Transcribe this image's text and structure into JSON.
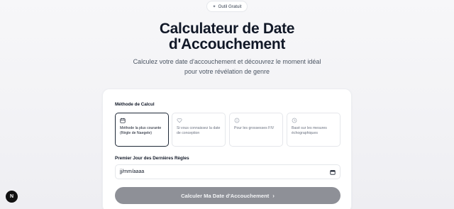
{
  "badge": {
    "label": "Outil Gratuit",
    "icon": "sparkle-icon"
  },
  "header": {
    "title_line1": "Calculateur de Date",
    "title_line2": "d'Accouchement",
    "subtitle": "Calculez votre date d'accouchement et découvrez le moment idéal pour votre révélation de genre"
  },
  "form": {
    "method_label": "Méthode de Calcul",
    "methods": [
      {
        "icon": "calendar-icon",
        "label": "Méthode la plus courante (Règle de Naegele)",
        "selected": true
      },
      {
        "icon": "heart-icon",
        "label": "Si vous connaissez la date de conception",
        "selected": false
      },
      {
        "icon": "info-circle-icon",
        "label": "Pour les grossesses FIV",
        "selected": false
      },
      {
        "icon": "clock-icon",
        "label": "Basé sur les mesures échographiques",
        "selected": false
      }
    ],
    "lmp_label": "Premier Jour des Dernières Règles",
    "date_placeholder": "jj/mm/aaaa",
    "submit_label": "Calculer Ma Date d'Accouchement",
    "submit_icon": "chevron-right-icon"
  },
  "fab": {
    "label": "N"
  },
  "colors": {
    "submit_bg": "#8e9097",
    "title": "#111827",
    "text_muted": "#6b7280"
  }
}
